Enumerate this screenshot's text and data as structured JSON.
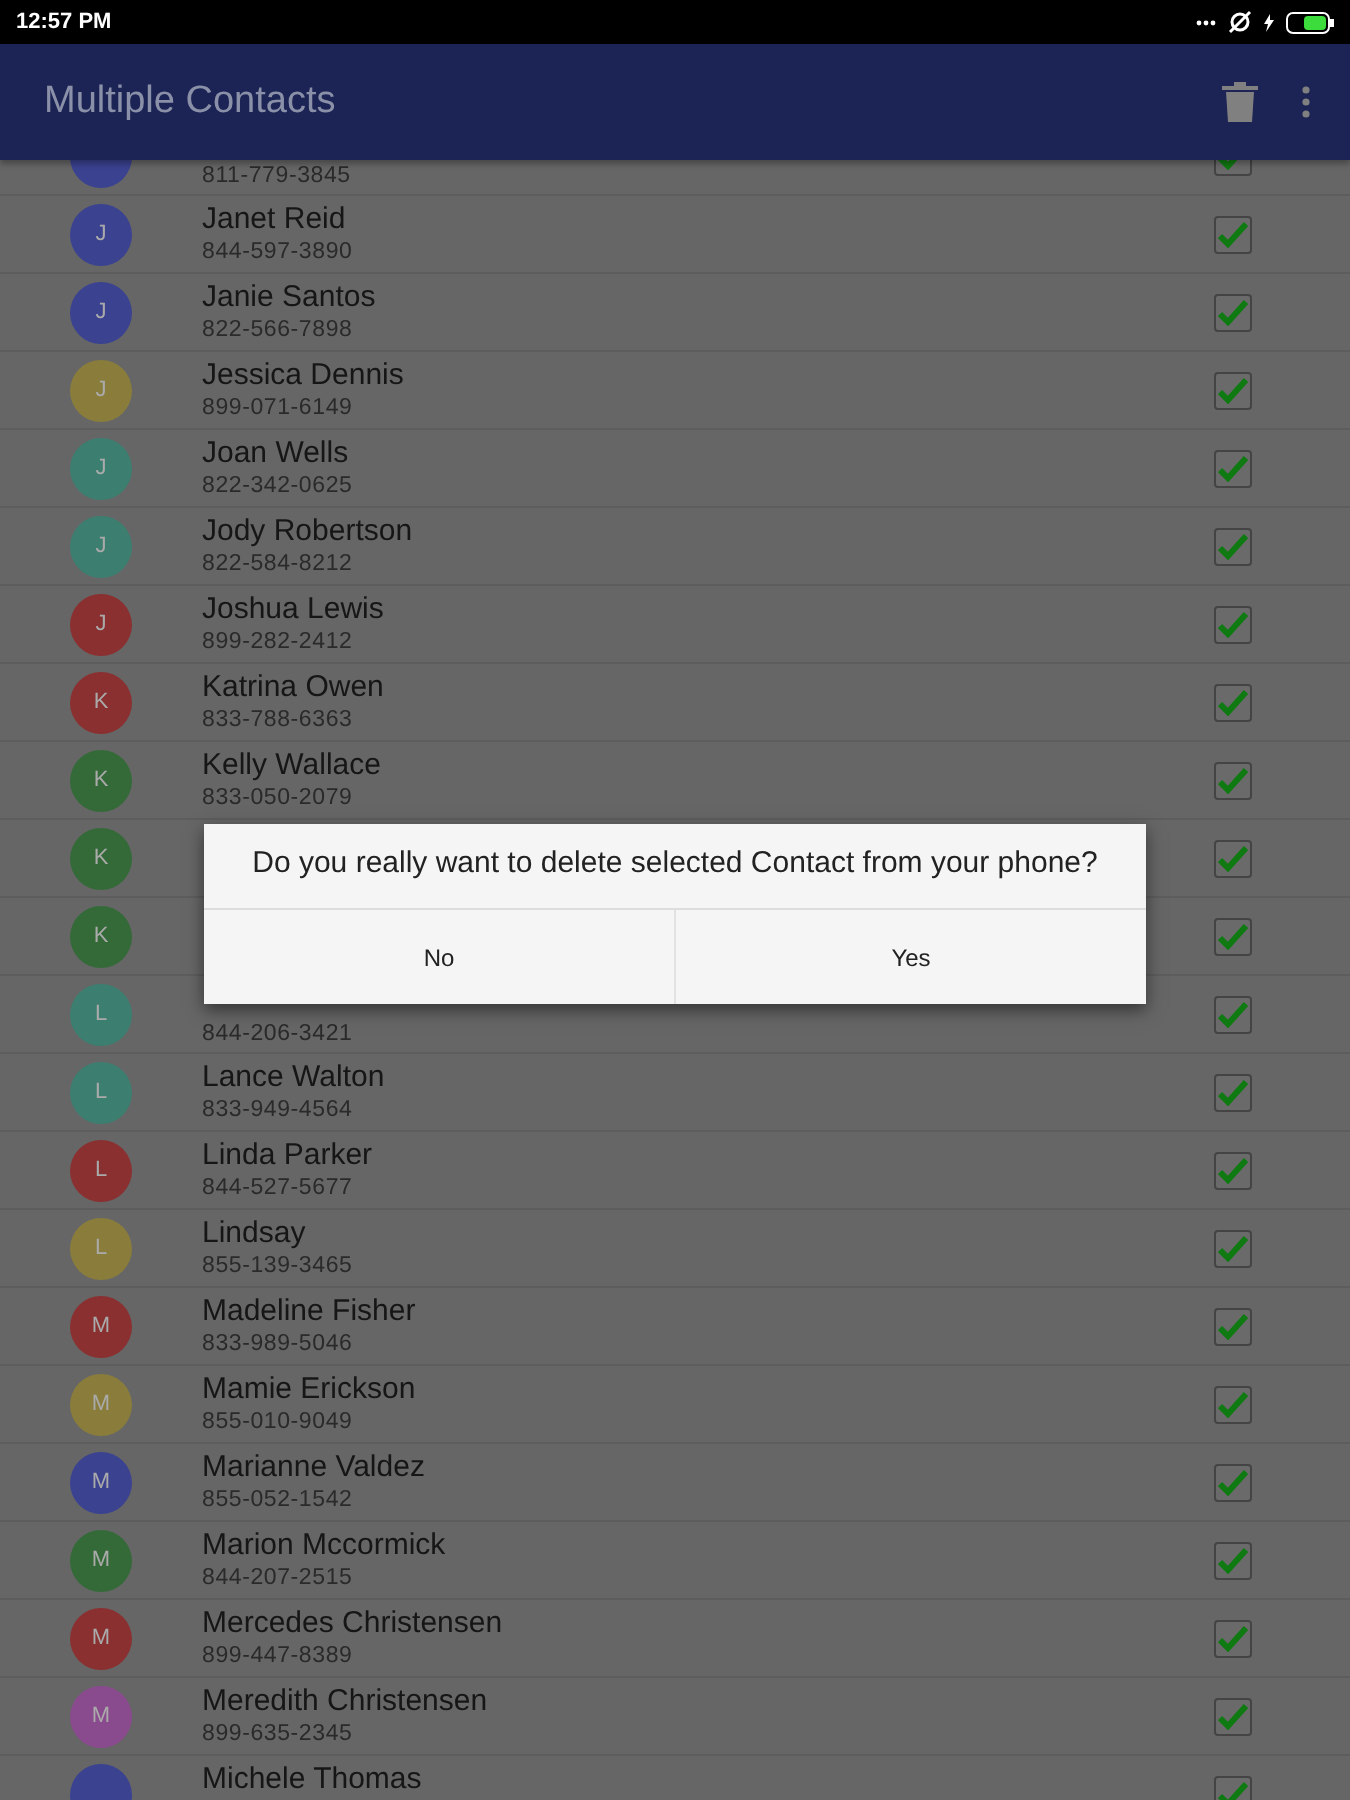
{
  "status_bar": {
    "time": "12:57 PM"
  },
  "app_bar": {
    "title": "Multiple Contacts"
  },
  "contacts": [
    {
      "phone": "811-779-3845",
      "color": "#3b4290",
      "checked": true
    },
    {
      "initial": "J",
      "name": "Janet Reid",
      "phone": "844-597-3890",
      "color": "#3b4290",
      "checked": true
    },
    {
      "initial": "J",
      "name": "Janie Santos",
      "phone": "822-566-7898",
      "color": "#3b4290",
      "checked": true
    },
    {
      "initial": "J",
      "name": "Jessica Dennis",
      "phone": "899-071-6149",
      "color": "#8a7d3c",
      "checked": true
    },
    {
      "initial": "J",
      "name": "Joan Wells",
      "phone": "822-342-0625",
      "color": "#3c7f70",
      "checked": true
    },
    {
      "initial": "J",
      "name": "Jody Robertson",
      "phone": "822-584-8212",
      "color": "#3c7f70",
      "checked": true
    },
    {
      "initial": "J",
      "name": "Joshua Lewis",
      "phone": "899-282-2412",
      "color": "#8a3030",
      "checked": true
    },
    {
      "initial": "K",
      "name": "Katrina Owen",
      "phone": "833-788-6363",
      "color": "#8a3030",
      "checked": true
    },
    {
      "initial": "K",
      "name": "Kelly Wallace",
      "phone": "833-050-2079",
      "color": "#346a38",
      "checked": true
    },
    {
      "initial": "K",
      "color": "#346a38",
      "checked": true
    },
    {
      "initial": "K",
      "color": "#346a38",
      "checked": true
    },
    {
      "initial": "L",
      "phone": "844-206-3421",
      "color": "#3c7f70",
      "checked": true
    },
    {
      "initial": "L",
      "name": "Lance Walton",
      "phone": "833-949-4564",
      "color": "#3c7f70",
      "checked": true
    },
    {
      "initial": "L",
      "name": "Linda Parker",
      "phone": "844-527-5677",
      "color": "#8a3030",
      "checked": true
    },
    {
      "initial": "L",
      "name": "Lindsay",
      "phone": "855-139-3465",
      "color": "#8a7d3c",
      "checked": true
    },
    {
      "initial": "M",
      "name": "Madeline Fisher",
      "phone": "833-989-5046",
      "color": "#8a3030",
      "checked": true
    },
    {
      "initial": "M",
      "name": "Mamie Erickson",
      "phone": "855-010-9049",
      "color": "#8a7d3c",
      "checked": true
    },
    {
      "initial": "M",
      "name": "Marianne Valdez",
      "phone": "855-052-1542",
      "color": "#3b4290",
      "checked": true
    },
    {
      "initial": "M",
      "name": "Marion Mccormick",
      "phone": "844-207-2515",
      "color": "#346a38",
      "checked": true
    },
    {
      "initial": "M",
      "name": "Mercedes Christensen",
      "phone": "899-447-8389",
      "color": "#8a3030",
      "checked": true
    },
    {
      "initial": "M",
      "name": "Meredith Christensen",
      "phone": "899-635-2345",
      "color": "#8a4a8e",
      "checked": true
    },
    {
      "name": "Michele Thomas",
      "color": "#3b4290",
      "checked": true
    }
  ],
  "dialog": {
    "message": "Do you really want to delete selected Contact from your phone?",
    "buttons": [
      "No",
      "Yes"
    ]
  }
}
